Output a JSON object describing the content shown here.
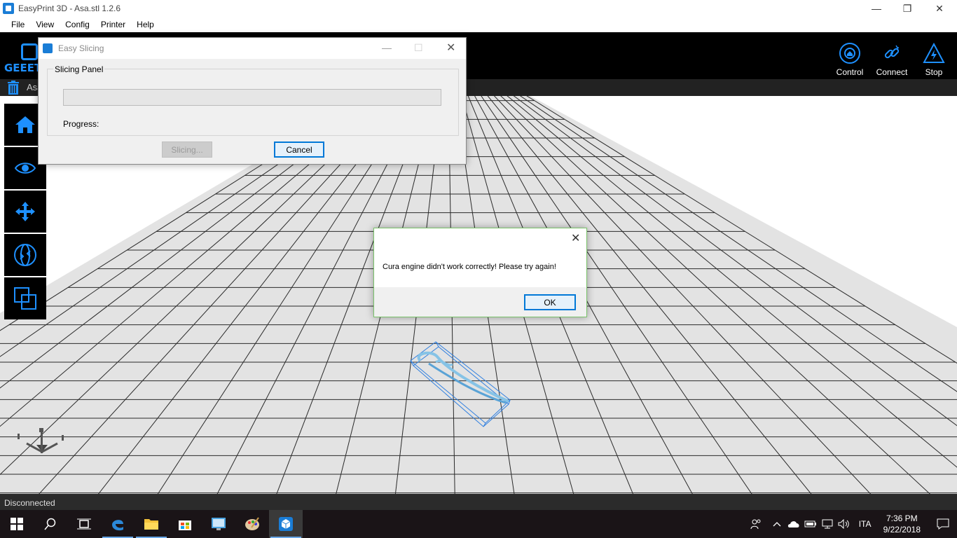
{
  "window": {
    "title": "EasyPrint 3D - Asa.stl  1.2.6",
    "minimize": "—",
    "maximize": "❐",
    "close": "✕"
  },
  "menu": [
    "File",
    "View",
    "Config",
    "Printer",
    "Help"
  ],
  "logo": "GEEET",
  "toolbar": {
    "control": "Control",
    "connect": "Connect",
    "stop": "Stop"
  },
  "file": {
    "name": "Asa"
  },
  "status": "Disconnected",
  "slicing_dialog": {
    "title": "Easy Slicing",
    "group_label": "Slicing Panel",
    "progress_label": "Progress:",
    "progress": 0,
    "slicing_button": "Slicing...",
    "cancel_button": "Cancel"
  },
  "message_dialog": {
    "message": "Cura engine didn't work correctly! Please try again!",
    "ok_button": "OK"
  },
  "taskbar": {
    "language": "ITA",
    "time": "7:36 PM",
    "date": "9/22/2018"
  },
  "colors": {
    "accent": "#1e90ff",
    "toolbar_bg": "#000000",
    "grid_line": "#222222",
    "plate": "#e3e3e3"
  }
}
